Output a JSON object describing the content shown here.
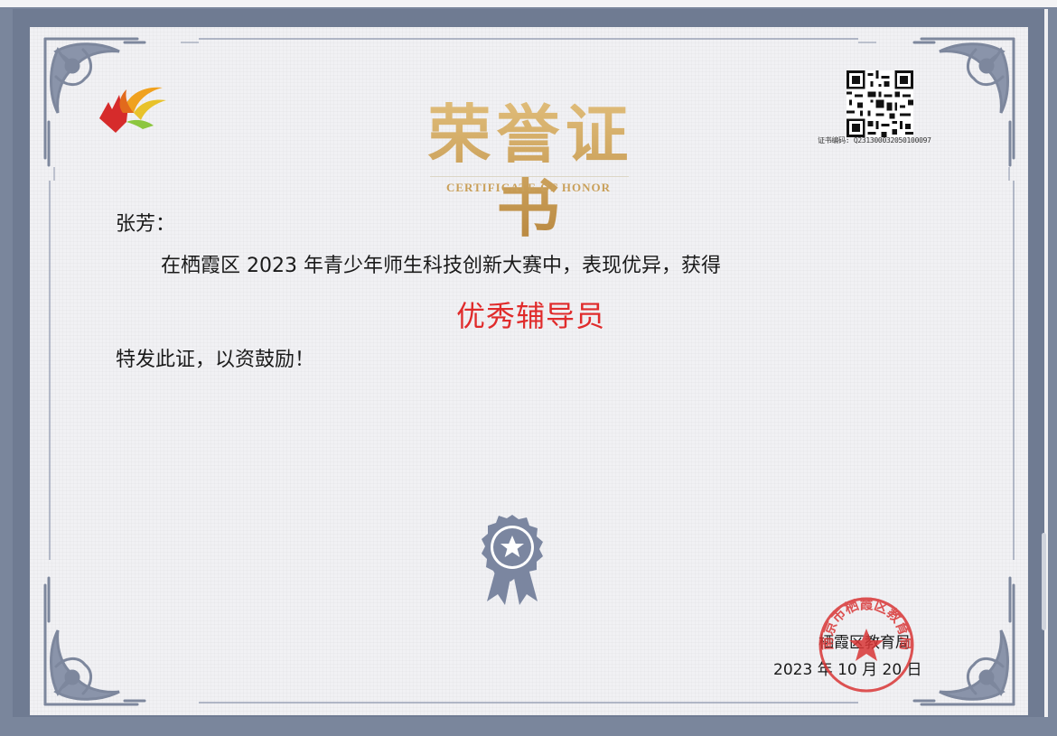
{
  "certificate": {
    "title": "荣誉证书",
    "subtitle": "CERTIFICATE OF HONOR",
    "certificate_number": "证书编码: Q231300032050100097",
    "recipient": "张芳：",
    "body": "在栖霞区 2023 年青少年师生科技创新大赛中，表现优异，获得",
    "award": "优秀辅导员",
    "closing": "特发此证，以资鼓励！",
    "issuer": "栖霞区教育局",
    "date": "2023 年 10 月 20 日"
  },
  "seal": {
    "text": "南京市栖霞区教育局"
  },
  "icons": {
    "logo": "logo-icon",
    "qr": "qr-code-icon",
    "badge": "award-badge-icon",
    "seal": "official-seal-icon",
    "corner": "ornament-corner-icon"
  },
  "colors": {
    "frame": "#6f7b92",
    "paper": "#f1f1f4",
    "title_gold": "#c9a05a",
    "award_red": "#e02b2b",
    "seal_red": "#d93636",
    "border": "#8a94aa"
  }
}
